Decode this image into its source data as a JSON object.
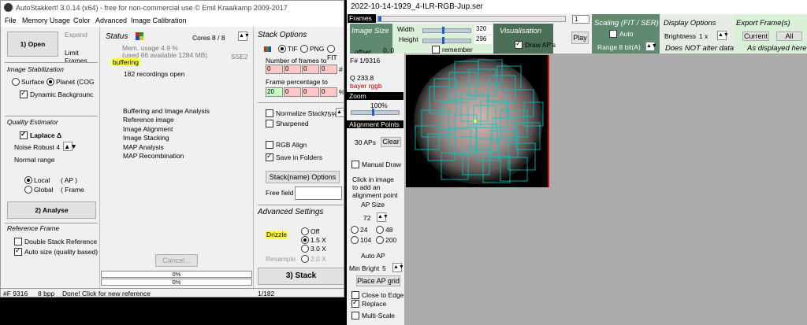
{
  "left": {
    "title": "AutoStakkert! 3.0.14 (x64) - free for non-commercial use © Emil Kraaikamp 2009-2017",
    "menu": [
      "File",
      "Memory Usage",
      "Color",
      "Advanced",
      "Image Calibration"
    ],
    "open_label": "1) Open",
    "expand_label": "Expand",
    "limit_frames_label": "Limit Frames",
    "image_stabilization": "Image Stabilization",
    "surface_label": "Surface",
    "planet_label": "Planet (COG",
    "dynamic_bg_label": "Dynamic Backgrounc",
    "quality_estimator": "Quality Estimator",
    "laplace_label": "Laplace Δ",
    "noise_robust_label": "Noise Robust 4",
    "normal_range_label": "Normal range",
    "local_label": "Local",
    "local_paren": "( AP )",
    "global_label": "Global",
    "global_paren": "( Frame",
    "analyse_label": "2) Analyse",
    "reference_frame": "Reference Frame",
    "double_stack_label": "Double Stack Reference",
    "auto_size_label": "Auto size (quality based)",
    "status_title": "Status",
    "cores_label": "Cores 8 / 8",
    "mem_usage": "Mem. usage 4.9 %",
    "mem_detail": "(used 66 available 1284 MB)",
    "sse2": "SSE2",
    "buffering": "buffering",
    "recordings_open": "182 recordings open",
    "steps": [
      "Buffering and Image Analysis",
      "Reference image",
      "Image Alignment",
      "Image Stacking",
      "MAP Analysis",
      "MAP Recombination"
    ],
    "cancel_label": "Cancel...",
    "progress1": "0%",
    "progress2": "0%",
    "stack_options": "Stack Options",
    "tif_label": "TIF",
    "png_label": "PNG",
    "fit_label": "FIT",
    "frames_to_stack_label": "Number of frames to stack:",
    "frames_values": [
      "0",
      "0",
      "0",
      "0"
    ],
    "frames_suffix": "#",
    "percentage_label": "Frame percentage to stack:",
    "percentage_values": [
      "20",
      "0",
      "0",
      "0"
    ],
    "percentage_suffix": "%",
    "normalize_label": "Normalize Stack",
    "normalize_value": "75%",
    "sharpened_label": "Sharpened",
    "rgb_align_label": "RGB Align",
    "save_folders_label": "Save in Folders",
    "stack_name_options": "Stack(name) Options",
    "free_field_label": "Free field",
    "advanced_settings": "Advanced Settings",
    "drizzle_label": "Drizzle",
    "drizzle_off": "Off",
    "drizzle_15": "1.5 X",
    "drizzle_30": "3.0 X",
    "resample_label": "Resample",
    "resample_20": "2.0 X",
    "stack_label": "3) Stack",
    "status_frame": "#F 9316",
    "status_bpp": "8 bpp",
    "status_msg": "Done! Click for new reference",
    "status_count": "1/182"
  },
  "right": {
    "title": "2022-10-14-1929_4-ILR-RGB-Jup.ser",
    "frames_label": "Frames",
    "frame_input": "1",
    "image_size_title": "Image Size",
    "width_label": "Width",
    "width_value": "320",
    "height_label": "Height",
    "height_value": "296",
    "remember_label": "remember",
    "offset_label": "offset",
    "offset_value": "0, 0",
    "visualisation_title": "Visualisation",
    "draw_aps_label": "Draw AP's",
    "play_label": "Play",
    "scaling_title": "Scaling (FIT / SER)",
    "auto_label": "Auto",
    "range_label": "Range 8 bit(A)",
    "display_title": "Display Options",
    "brightness_label": "Brightness",
    "brightness_value": "1 x",
    "not_alter": "Does NOT alter data!",
    "export_title": "Export Frame(s)",
    "current_label": "Current",
    "all_label": "All",
    "as_displayed": "As displayed here",
    "frame_number": "F# 1/9316",
    "q_value": "Q  233.8",
    "bayer": "bayer rggb",
    "zoom_title": "Zoom",
    "zoom_value": "100%",
    "ap_title": "Alignment Points",
    "aps_count": "30 APs",
    "clear_label": "Clear",
    "manual_draw_label": "Manual Draw",
    "click_hint": "Click in image to add an alignment point",
    "ap_size_label": "AP Size",
    "ap_size_value": "72",
    "ap_sizes": [
      "24",
      "48",
      "104",
      "200"
    ],
    "auto_ap_label": "Auto AP",
    "min_bright_label": "Min Bright",
    "min_bright_value": "5",
    "place_ap_label": "Place AP grid",
    "close_edge_label": "Close to Edge",
    "replace_label": "Replace",
    "multi_scale_label": "Multi-Scale"
  },
  "colors": {
    "accent_yellow": "#ffff40",
    "teal_box": "#00c8c8",
    "panel_green": "#5f8a6f",
    "bayer_red": "#c00000"
  }
}
